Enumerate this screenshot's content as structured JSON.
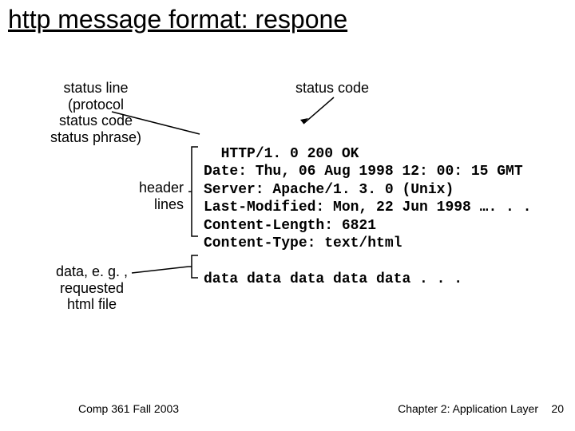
{
  "title": "http message format: respone",
  "labels": {
    "status_code": "status code",
    "status_line_l1": "status line",
    "status_line_l2": "(protocol",
    "status_line_l3": "status code",
    "status_line_l4": "status phrase)",
    "header_l1": "header",
    "header_l2": "lines",
    "data_l1": "data, e. g. ,",
    "data_l2": "requested",
    "data_l3": "html file"
  },
  "code": {
    "l1": "HTTP/1. 0 200 OK",
    "l2": "Date: Thu, 06 Aug 1998 12: 00: 15 GMT",
    "l3": "Server: Apache/1. 3. 0 (Unix)",
    "l4": "Last-Modified: Mon, 22 Jun 1998 …. . .",
    "l5": "Content-Length: 6821",
    "l6": "Content-Type: text/html",
    "l7": "data data data data data . . ."
  },
  "footer": {
    "left": "Comp 361   Fall 2003",
    "right": "Chapter 2: Application Layer",
    "page": "20"
  }
}
